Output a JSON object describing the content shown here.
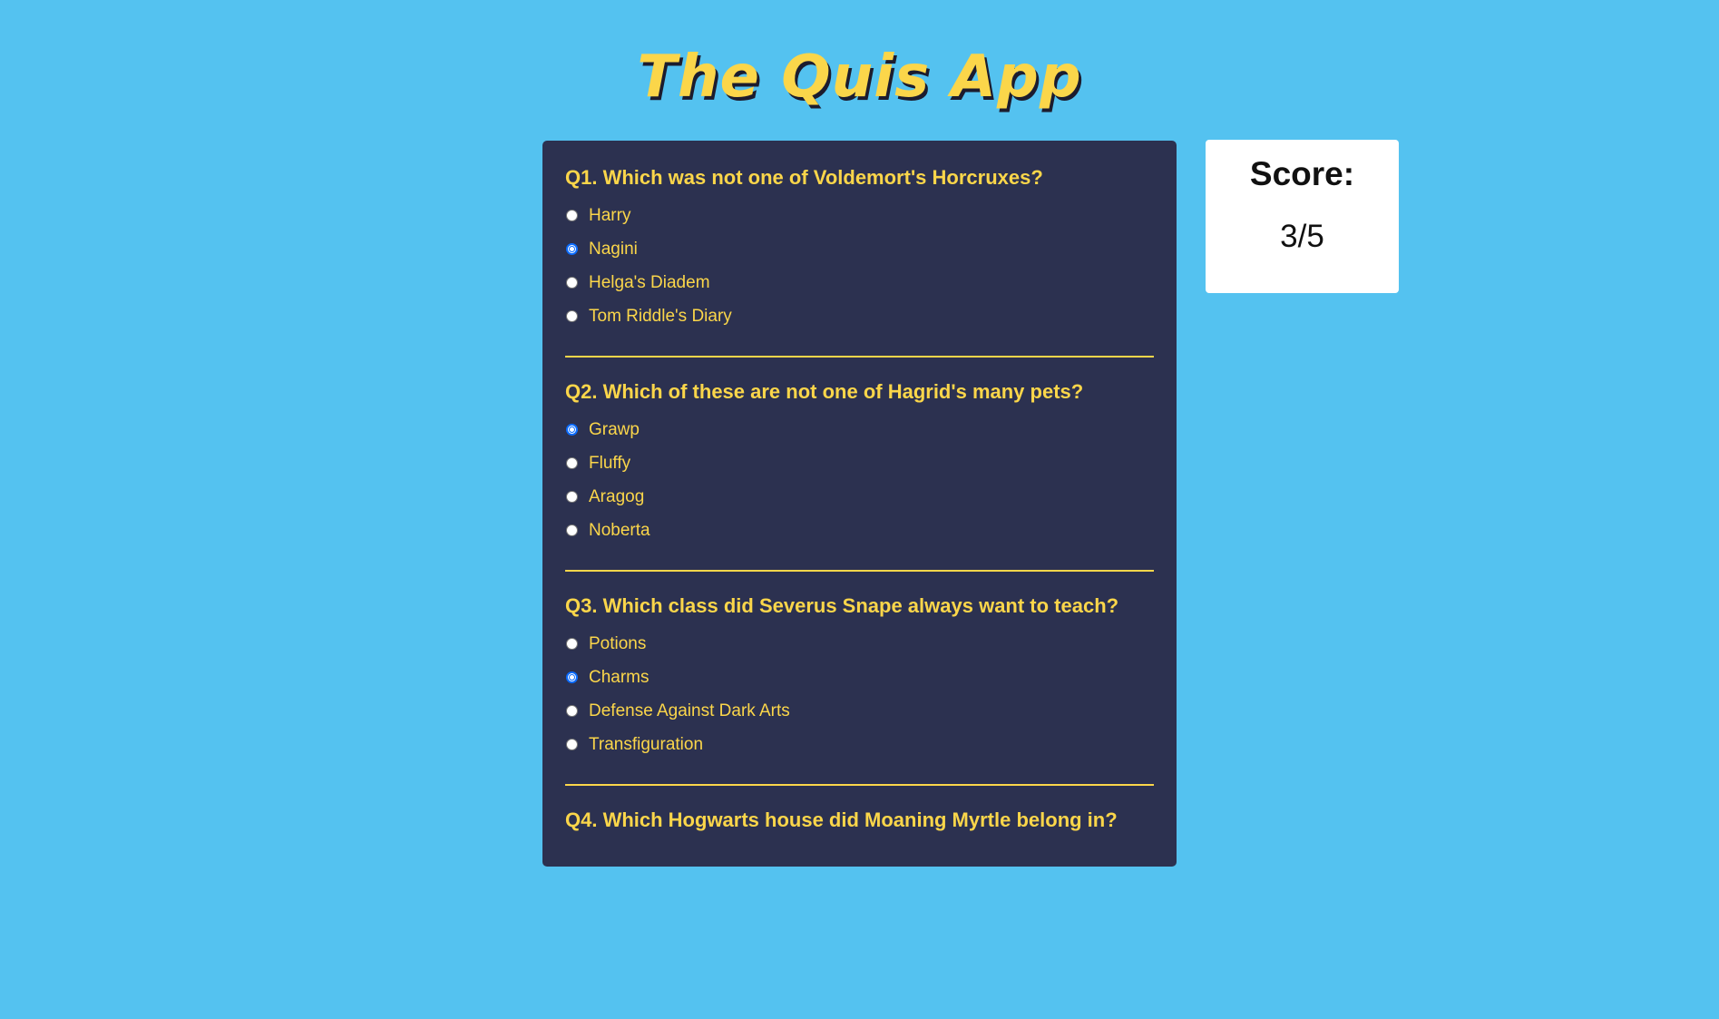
{
  "app": {
    "title": "The Quis App"
  },
  "score": {
    "label": "Score:",
    "value": "3/5"
  },
  "questions": [
    {
      "title": "Q1. Which was not one of Voldemort's Horcruxes?",
      "options": [
        {
          "label": "Harry",
          "selected": false
        },
        {
          "label": "Nagini",
          "selected": true
        },
        {
          "label": "Helga's Diadem",
          "selected": false
        },
        {
          "label": "Tom Riddle's Diary",
          "selected": false
        }
      ]
    },
    {
      "title": "Q2. Which of these are not one of Hagrid's many pets?",
      "options": [
        {
          "label": "Grawp",
          "selected": true
        },
        {
          "label": "Fluffy",
          "selected": false
        },
        {
          "label": "Aragog",
          "selected": false
        },
        {
          "label": "Noberta",
          "selected": false
        }
      ]
    },
    {
      "title": "Q3. Which class did Severus Snape always want to teach?",
      "options": [
        {
          "label": "Potions",
          "selected": false
        },
        {
          "label": "Charms",
          "selected": true
        },
        {
          "label": "Defense Against Dark Arts",
          "selected": false
        },
        {
          "label": "Transfiguration",
          "selected": false
        }
      ]
    },
    {
      "title": "Q4. Which Hogwarts house did Moaning Myrtle belong in?",
      "options": []
    }
  ],
  "colors": {
    "page_background": "#54c2f0",
    "panel_background": "#2c3150",
    "accent_yellow": "#fbd64a",
    "radio_selected": "#0b6cff",
    "card_background": "#ffffff"
  }
}
